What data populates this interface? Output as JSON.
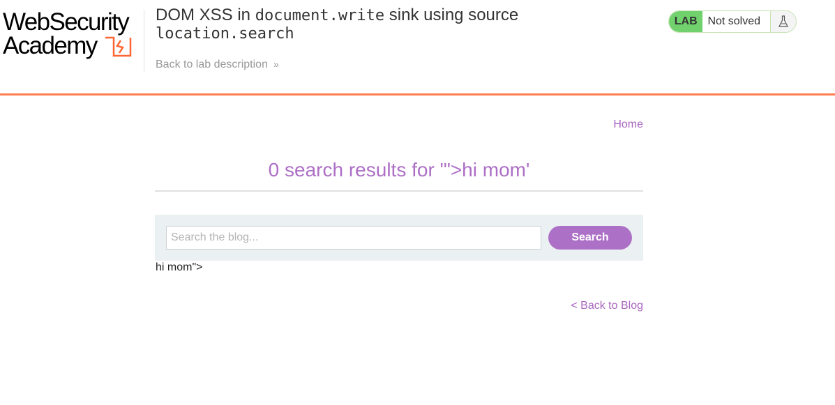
{
  "header": {
    "logo_line1": "WebSecurity",
    "logo_line2": "Academy",
    "title_prefix": "DOM XSS in ",
    "title_code1": "document.write",
    "title_middle": " sink using source",
    "title_code2": "location.search",
    "back_link": "Back to lab description"
  },
  "status": {
    "lab_label": "LAB",
    "state": "Not solved",
    "icon": "flask-icon"
  },
  "nav": {
    "home": "Home"
  },
  "main": {
    "results_heading": "0 search results for '\">hi mom'",
    "search_placeholder": "Search the blog...",
    "search_value": "",
    "search_button": "Search",
    "written_text": "hi mom\">",
    "back_to_blog": "< Back to Blog"
  },
  "colors": {
    "accent": "#ad70c7",
    "brand_orange": "#ff6633",
    "lab_green": "#70d16d"
  }
}
